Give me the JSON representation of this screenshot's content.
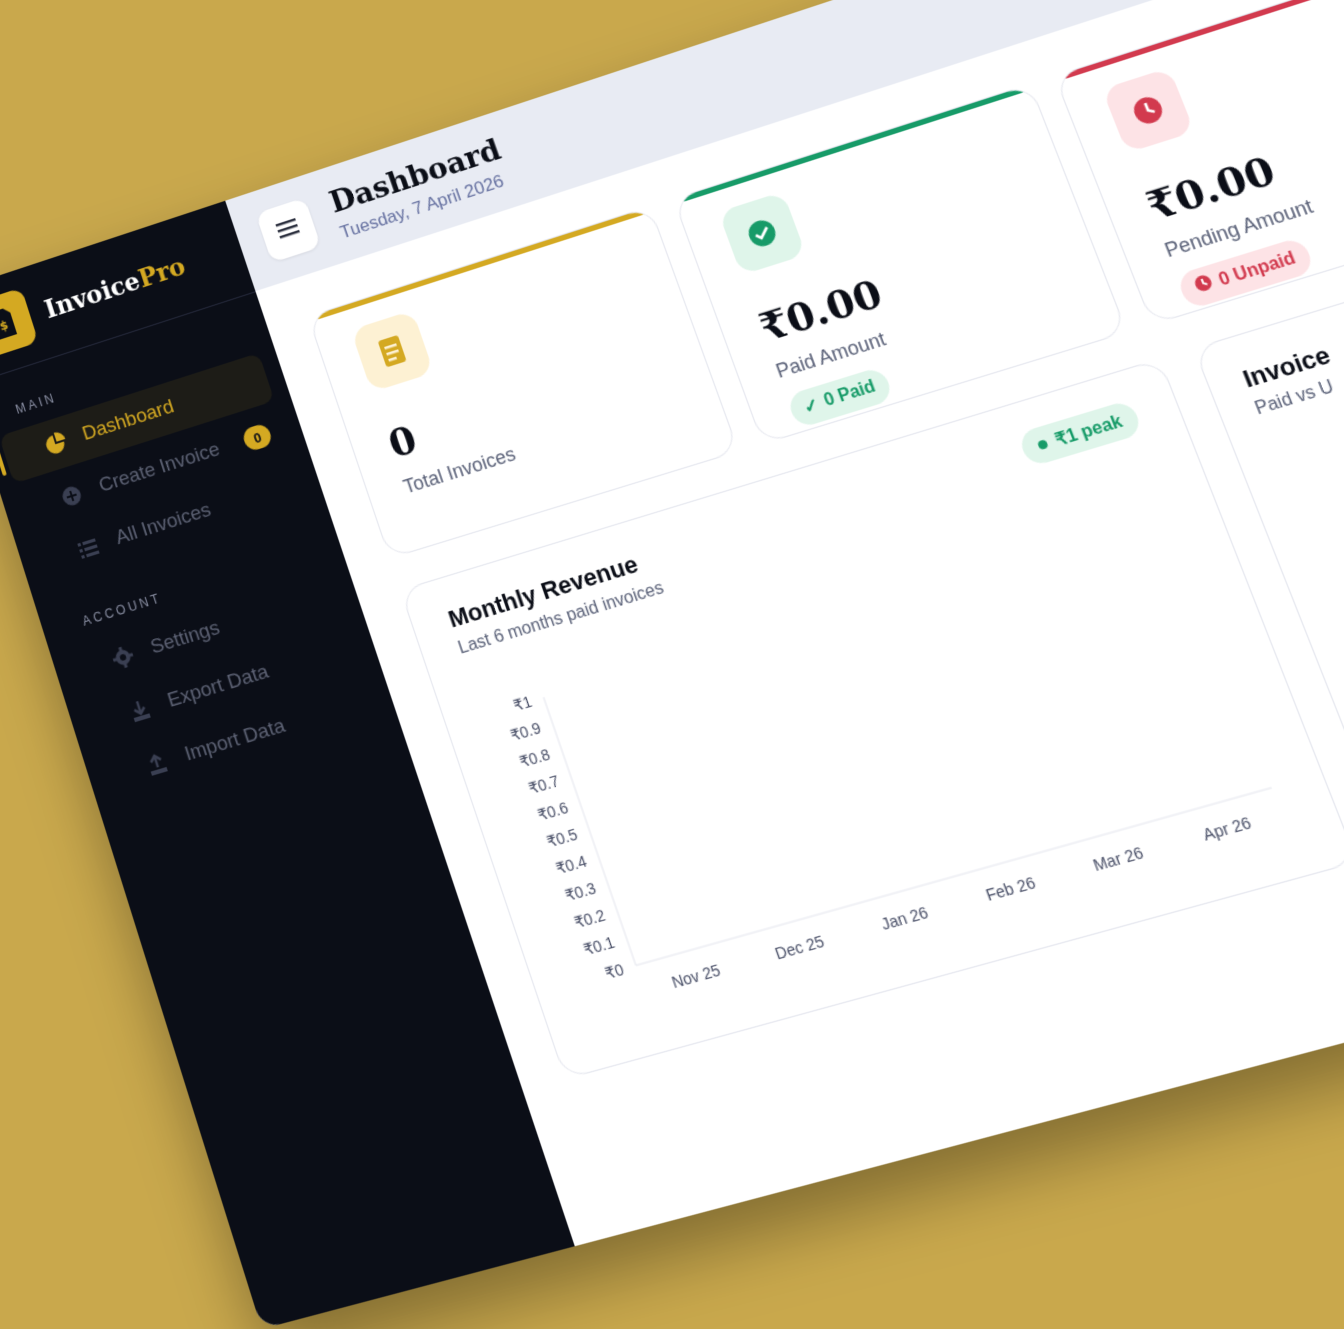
{
  "brand": {
    "name": "Invoice",
    "name_accent": "Pro"
  },
  "sidebar": {
    "sections": [
      {
        "label": "MAIN"
      },
      {
        "label": "ACCOUNT"
      }
    ],
    "items": [
      {
        "label": "Dashboard",
        "icon": "pie-chart-icon"
      },
      {
        "label": "Create Invoice",
        "icon": "plus-circle-icon",
        "badge": "0"
      },
      {
        "label": "All Invoices",
        "icon": "list-icon"
      },
      {
        "label": "Settings",
        "icon": "gear-icon"
      },
      {
        "label": "Export Data",
        "icon": "download-icon"
      },
      {
        "label": "Import Data",
        "icon": "upload-icon"
      }
    ]
  },
  "header": {
    "title": "Dashboard",
    "date": "Tuesday, 7 April 2026"
  },
  "cards": [
    {
      "value": "0",
      "label": "Total Invoices",
      "accent": "#d4a922",
      "icon": "invoice-icon"
    },
    {
      "value": "₹0.00",
      "label": "Paid Amount",
      "pill": "0 Paid",
      "accent": "#179b68",
      "icon": "check-circle-icon"
    },
    {
      "value": "₹0.00",
      "label": "Pending Amount",
      "pill": "0 Unpaid",
      "accent": "#d23a4e",
      "icon": "clock-icon"
    }
  ],
  "revenue": {
    "title": "Monthly Revenue",
    "subtitle": "Last 6 months paid invoices",
    "peak": "₹1 peak"
  },
  "side_panel": {
    "title": "Invoice",
    "subtitle": "Paid vs U"
  },
  "chart_data": {
    "type": "bar",
    "categories": [
      "Nov 25",
      "Dec 25",
      "Jan 26",
      "Feb 26",
      "Mar 26",
      "Apr 26"
    ],
    "values": [
      0,
      0,
      0,
      0,
      0,
      0
    ],
    "title": "Monthly Revenue",
    "subtitle": "Last 6 months paid invoices",
    "xlabel": "",
    "ylabel": "",
    "ylim": [
      0,
      1
    ],
    "yticks": [
      "₹0",
      "₹0.1",
      "₹0.2",
      "₹0.3",
      "₹0.4",
      "₹0.5",
      "₹0.6",
      "₹0.7",
      "₹0.8",
      "₹0.9",
      "₹1"
    ],
    "grid": false
  }
}
